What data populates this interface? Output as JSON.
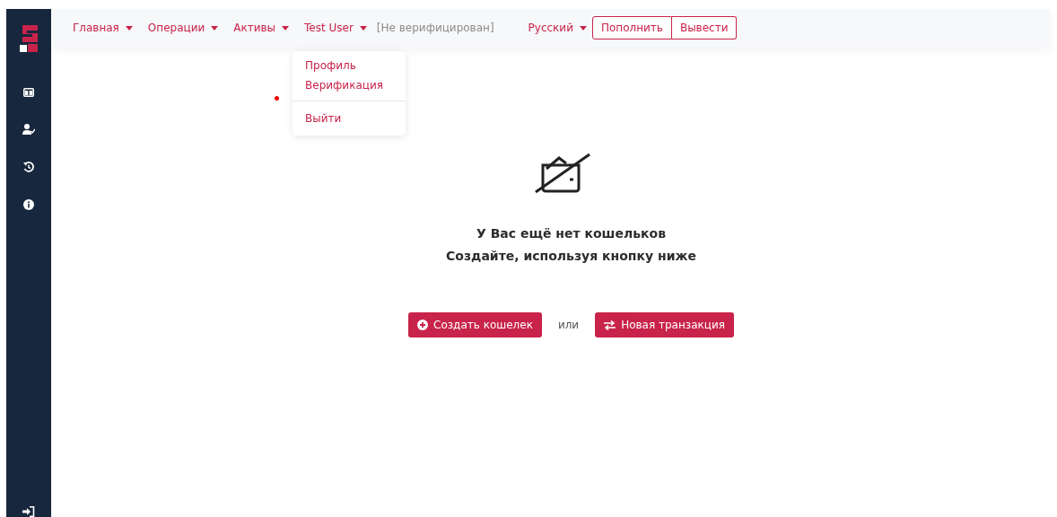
{
  "nav": [
    {
      "label": "Главная"
    },
    {
      "label": "Операции"
    },
    {
      "label": "Активы"
    },
    {
      "label": "Test User",
      "menu": [
        {
          "label": "Профиль",
          "separated": false
        },
        {
          "label": "Верификация",
          "separated": false
        },
        {
          "label": "Выйти",
          "separated": true
        }
      ]
    }
  ],
  "status": "[Не верифицирован]",
  "language": "Русский",
  "actions": [
    "Пополнить",
    "Вывести"
  ],
  "empty_state": {
    "title": "У Вас ещё нет кошельков",
    "subtitle": "Создайте, используя кнопку ниже",
    "buttons": [
      {
        "label": "Создать кошелек",
        "kind": "create"
      },
      {
        "label": "Новая транзакция",
        "kind": "transfer"
      }
    ],
    "separator": "или"
  }
}
